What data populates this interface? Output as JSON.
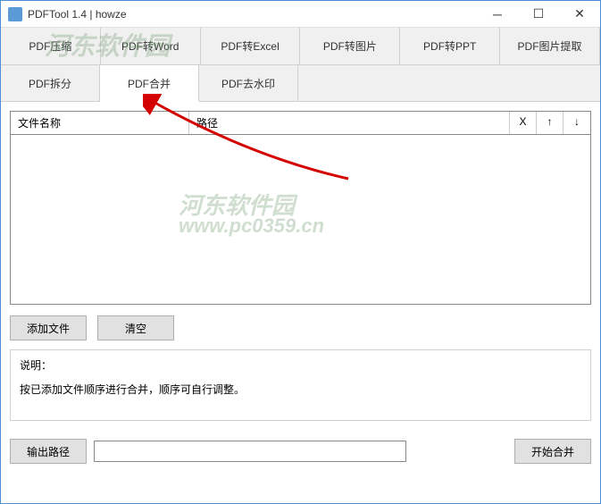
{
  "window": {
    "title": "PDFTool 1.4 | howze"
  },
  "tabs_row1": [
    {
      "label": "PDF压缩"
    },
    {
      "label": "PDF转Word"
    },
    {
      "label": "PDF转Excel"
    },
    {
      "label": "PDF转图片"
    },
    {
      "label": "PDF转PPT"
    },
    {
      "label": "PDF图片提取"
    }
  ],
  "tabs_row2": [
    {
      "label": "PDF拆分"
    },
    {
      "label": "PDF合并",
      "active": true
    },
    {
      "label": "PDF去水印"
    }
  ],
  "list": {
    "headers": {
      "name": "文件名称",
      "path": "路径",
      "remove": "X",
      "up": "↑",
      "down": "↓"
    }
  },
  "buttons": {
    "add_file": "添加文件",
    "clear": "清空",
    "output_path": "输出路径",
    "start_merge": "开始合并"
  },
  "description": {
    "label": "说明：",
    "text": "按已添加文件顺序进行合并，顺序可自行调整。"
  },
  "output": {
    "path_value": ""
  },
  "watermark": {
    "text1": "河东软件园",
    "text2": "河东软件园",
    "text3": "www.pc0359.cn"
  }
}
